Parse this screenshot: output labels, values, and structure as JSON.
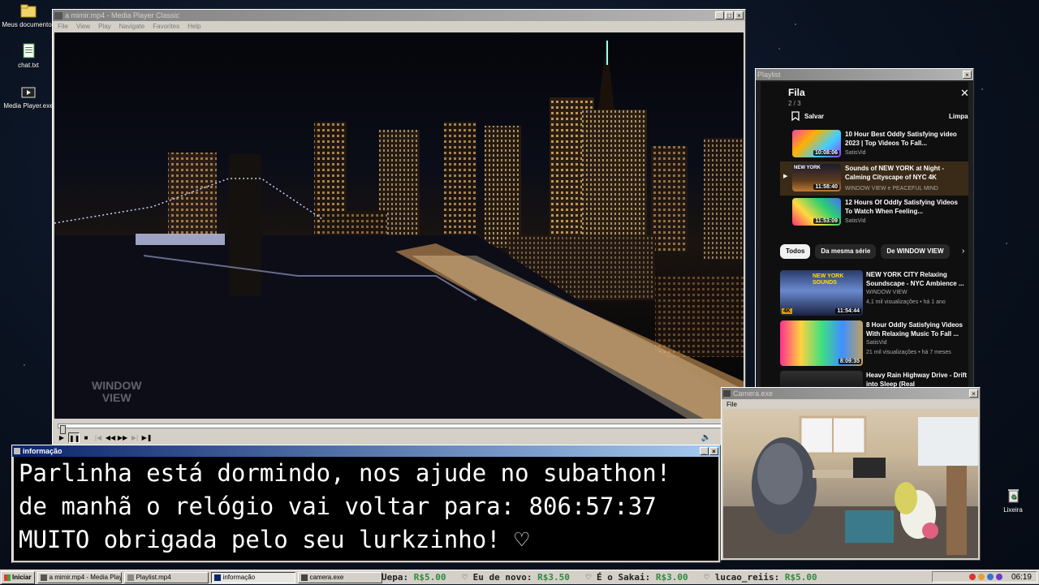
{
  "desktop": {
    "icons": [
      {
        "label": "Meus documentos"
      },
      {
        "label": "chat.txt"
      },
      {
        "label": "Media Player.exe"
      },
      {
        "label": "Lixeira"
      }
    ]
  },
  "mpc": {
    "title": "a mimir.mp4 - Media Player Classic",
    "menu": [
      "File",
      "View",
      "Play",
      "Navigate",
      "Favorites",
      "Help"
    ],
    "watermark_line1": "WINDOW",
    "watermark_line2": "VIEW",
    "seek_position": 0
  },
  "playlist": {
    "title": "Playlist",
    "queue_title": "Fila",
    "queue_count": "2 / 3",
    "save_label": "Salvar",
    "clear_label": "Limpa",
    "queue": [
      {
        "title": "10 Hour Best Oddly Satisfying video 2023 | Top Videos To Fall...",
        "channel": "SatisVid",
        "duration": "10:08:06"
      },
      {
        "title": "Sounds of NEW YORK at Night - Calming Cityscape of NYC 4K",
        "channel": "WINDOW VIEW e PEACEFUL MIND",
        "duration": "11:58:40",
        "thumb_text": "NEW YORK"
      },
      {
        "title": "12 Hours Of Oddly Satisfying Videos To Watch When Feeling...",
        "channel": "SatisVid",
        "duration": "11:53:09"
      }
    ],
    "chips": [
      "Todos",
      "Da mesma série",
      "De WINDOW VIEW"
    ],
    "related": [
      {
        "title": "NEW YORK CITY Relaxing Soundscape - NYC Ambience ...",
        "channel": "WINDOW VIEW",
        "meta": "4,1 mil visualizações • há 1 ano",
        "duration": "11:54:44",
        "badge": "4K",
        "thumb_text": "NEW YORK SOUNDS"
      },
      {
        "title": "8 Hour Oddly Satisfying Videos With Relaxing Music To Fall ...",
        "channel": "SatisVid",
        "meta": "21 mil visualizações • há 7 meses",
        "duration": "8:09:35"
      },
      {
        "title": "Heavy Rain Highway Drive - Drift into Sleep (Real",
        "channel": "",
        "meta": ""
      }
    ]
  },
  "info": {
    "title": "informação",
    "lines": [
      "Parlinha está dormindo, nos ajude no subathon!",
      "de manhã o relógio vai voltar para:  806:57:37",
      "MUITO obrigada pelo seu lurkzinho! ♡"
    ]
  },
  "camera": {
    "title": "Camera.exe",
    "menu": "File"
  },
  "taskbar": {
    "start_label": "Iniciar",
    "tasks": [
      {
        "label": "a mimir.mp4 - Media Playe..."
      },
      {
        "label": "Playlist.mp4"
      },
      {
        "label": "informação"
      },
      {
        "label": "camera.exe"
      }
    ],
    "donations": [
      {
        "name": "Uepa:",
        "amount": "R$5.00"
      },
      {
        "name": "Eu de novo:",
        "amount": "R$3.50"
      },
      {
        "name": "É o Sakai:",
        "amount": "R$3.00"
      },
      {
        "name": "lucao_reiis:",
        "amount": "R$5.00"
      }
    ],
    "clock": "06:19"
  },
  "colors": {
    "title_active": "#0a246a",
    "title_inactive": "#808080",
    "donation_green": "#2e8b3e",
    "youtube_bg": "#0f0f0f"
  }
}
